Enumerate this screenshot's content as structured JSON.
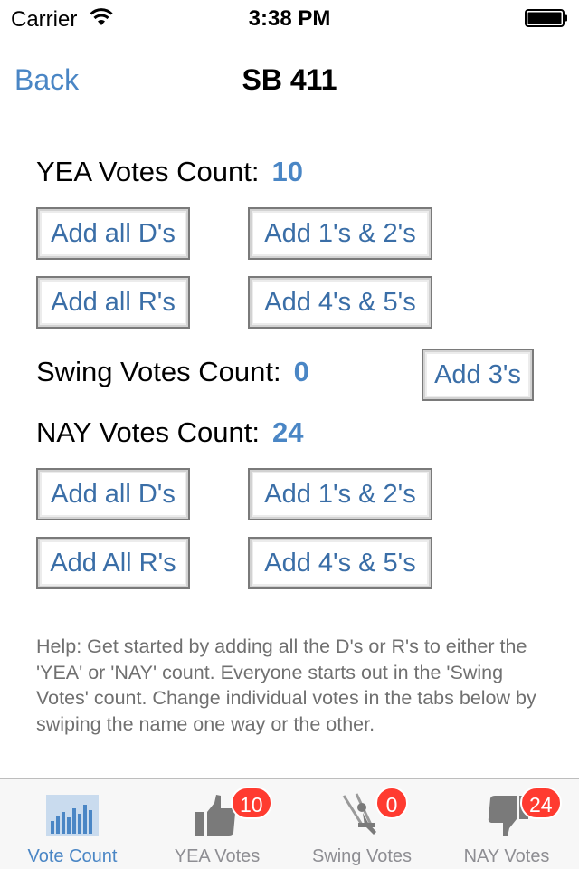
{
  "status_bar": {
    "carrier": "Carrier",
    "time": "3:38 PM"
  },
  "nav": {
    "back_label": "Back",
    "title": "SB 411"
  },
  "yea": {
    "label": "YEA Votes Count:",
    "count": "10",
    "buttons": {
      "add_d": "Add all D's",
      "add_12": "Add 1's & 2's",
      "add_r": "Add all R's",
      "add_45": "Add 4's & 5's"
    }
  },
  "swing": {
    "label": "Swing Votes Count:",
    "count": "0",
    "add_3_label": "Add 3's"
  },
  "nay": {
    "label": "NAY Votes Count:",
    "count": "24",
    "buttons": {
      "add_d": "Add all D's",
      "add_12": "Add 1's & 2's",
      "add_r": "Add All R's",
      "add_45": "Add 4's & 5's"
    }
  },
  "help_text": "Help: Get started by adding all the D's or R's to either the 'YEA' or 'NAY' count. Everyone starts out in the 'Swing Votes' count. Change individual votes in the tabs below by swiping the name one way or the other.",
  "tabs": [
    {
      "label": "Vote Count",
      "icon": "bar-chart-icon",
      "active": true
    },
    {
      "label": "YEA Votes",
      "icon": "thumbs-up-icon",
      "badge": "10"
    },
    {
      "label": "Swing Votes",
      "icon": "swing-icon",
      "badge": "0"
    },
    {
      "label": "NAY Votes",
      "icon": "thumbs-down-icon",
      "badge": "24"
    }
  ],
  "colors": {
    "accent": "#4a86c5",
    "badge": "#ff3b30",
    "tab_inactive": "#8e8e93"
  }
}
